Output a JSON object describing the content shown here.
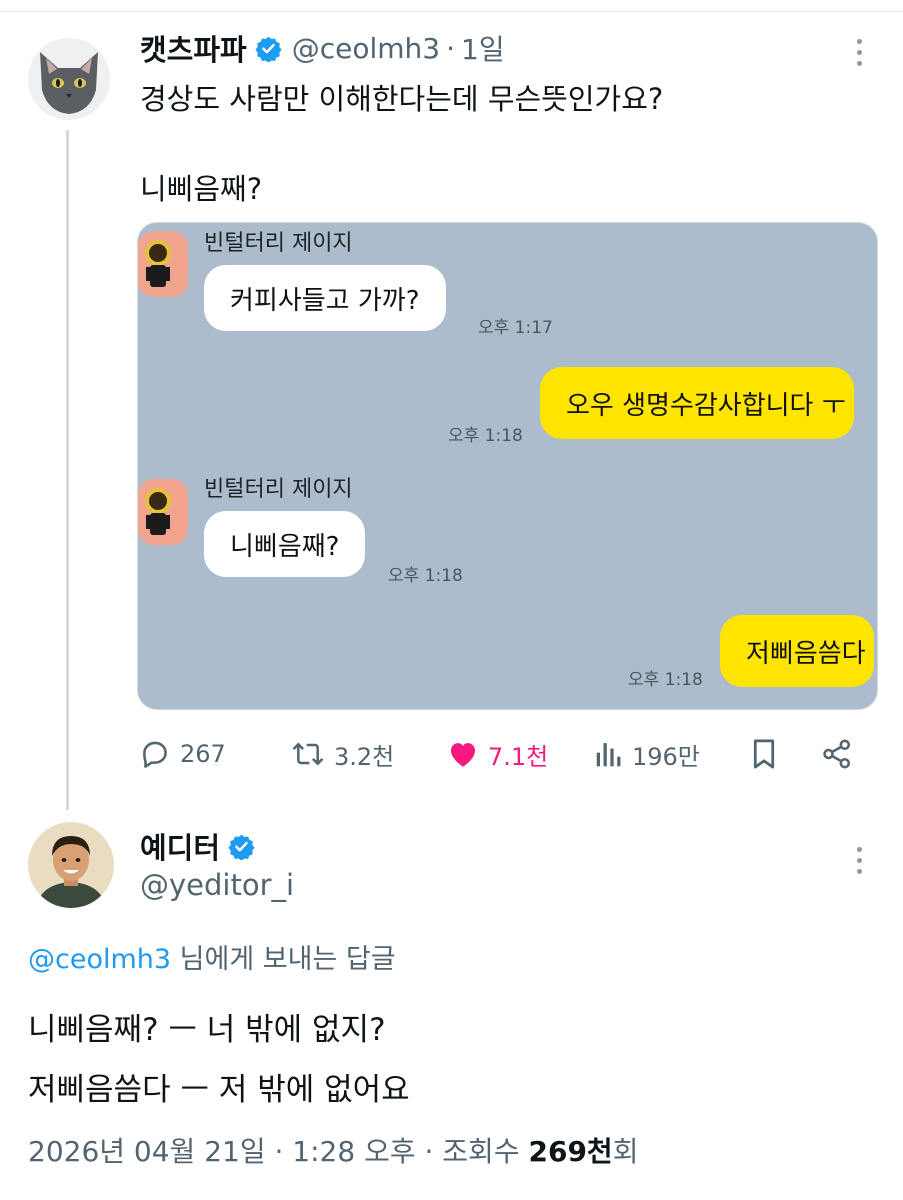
{
  "tweet": {
    "author_name": "캣츠파파",
    "author_handle": "@ceolmh3",
    "time_sep": "·",
    "time": "1일",
    "text_line1": "경상도 사람만 이해한다는데 무슨뜻인가요?",
    "text_line2": "니삐음째?",
    "stats": {
      "replies": "267",
      "retweets": "3.2천",
      "likes": "7.1천",
      "views": "196만"
    }
  },
  "chat": {
    "sender_name": "빈털터리 제이지",
    "messages": [
      {
        "side": "left",
        "text": "커피사들고 가까?",
        "time": "오후 1:17"
      },
      {
        "side": "right",
        "text": "오우 생명수감사합니다 ㅜ",
        "time": "오후 1:18"
      },
      {
        "side": "left",
        "text": "니삐음째?",
        "time": "오후 1:18"
      },
      {
        "side": "right",
        "text": "저삐음씀다",
        "time": "오후 1:18"
      }
    ]
  },
  "reply": {
    "author_name": "예디터",
    "author_handle": "@yeditor_i",
    "reply_to_mention": "@ceolmh3",
    "reply_to_suffix": " 님에게 보내는 답글",
    "line1": "니삐음째? ㅡ 너 밖에  없지?",
    "line2": "저삐음씀다 ㅡ 저 밖에 없어요",
    "meta_prefix": "2026년 04월 21일 · 1:28 오후 · 조회수 ",
    "meta_views": "269천",
    "meta_suffix": "회"
  },
  "colors": {
    "verified": "#1d9bf0",
    "like": "#f91880",
    "secondary_text": "#536471",
    "chat_bg": "#acbccd",
    "bubble_yellow": "#fee500"
  },
  "icons": [
    "verified-badge-icon",
    "more-icon",
    "reply-icon",
    "retweet-icon",
    "heart-icon",
    "views-icon",
    "bookmark-icon",
    "share-icon"
  ]
}
